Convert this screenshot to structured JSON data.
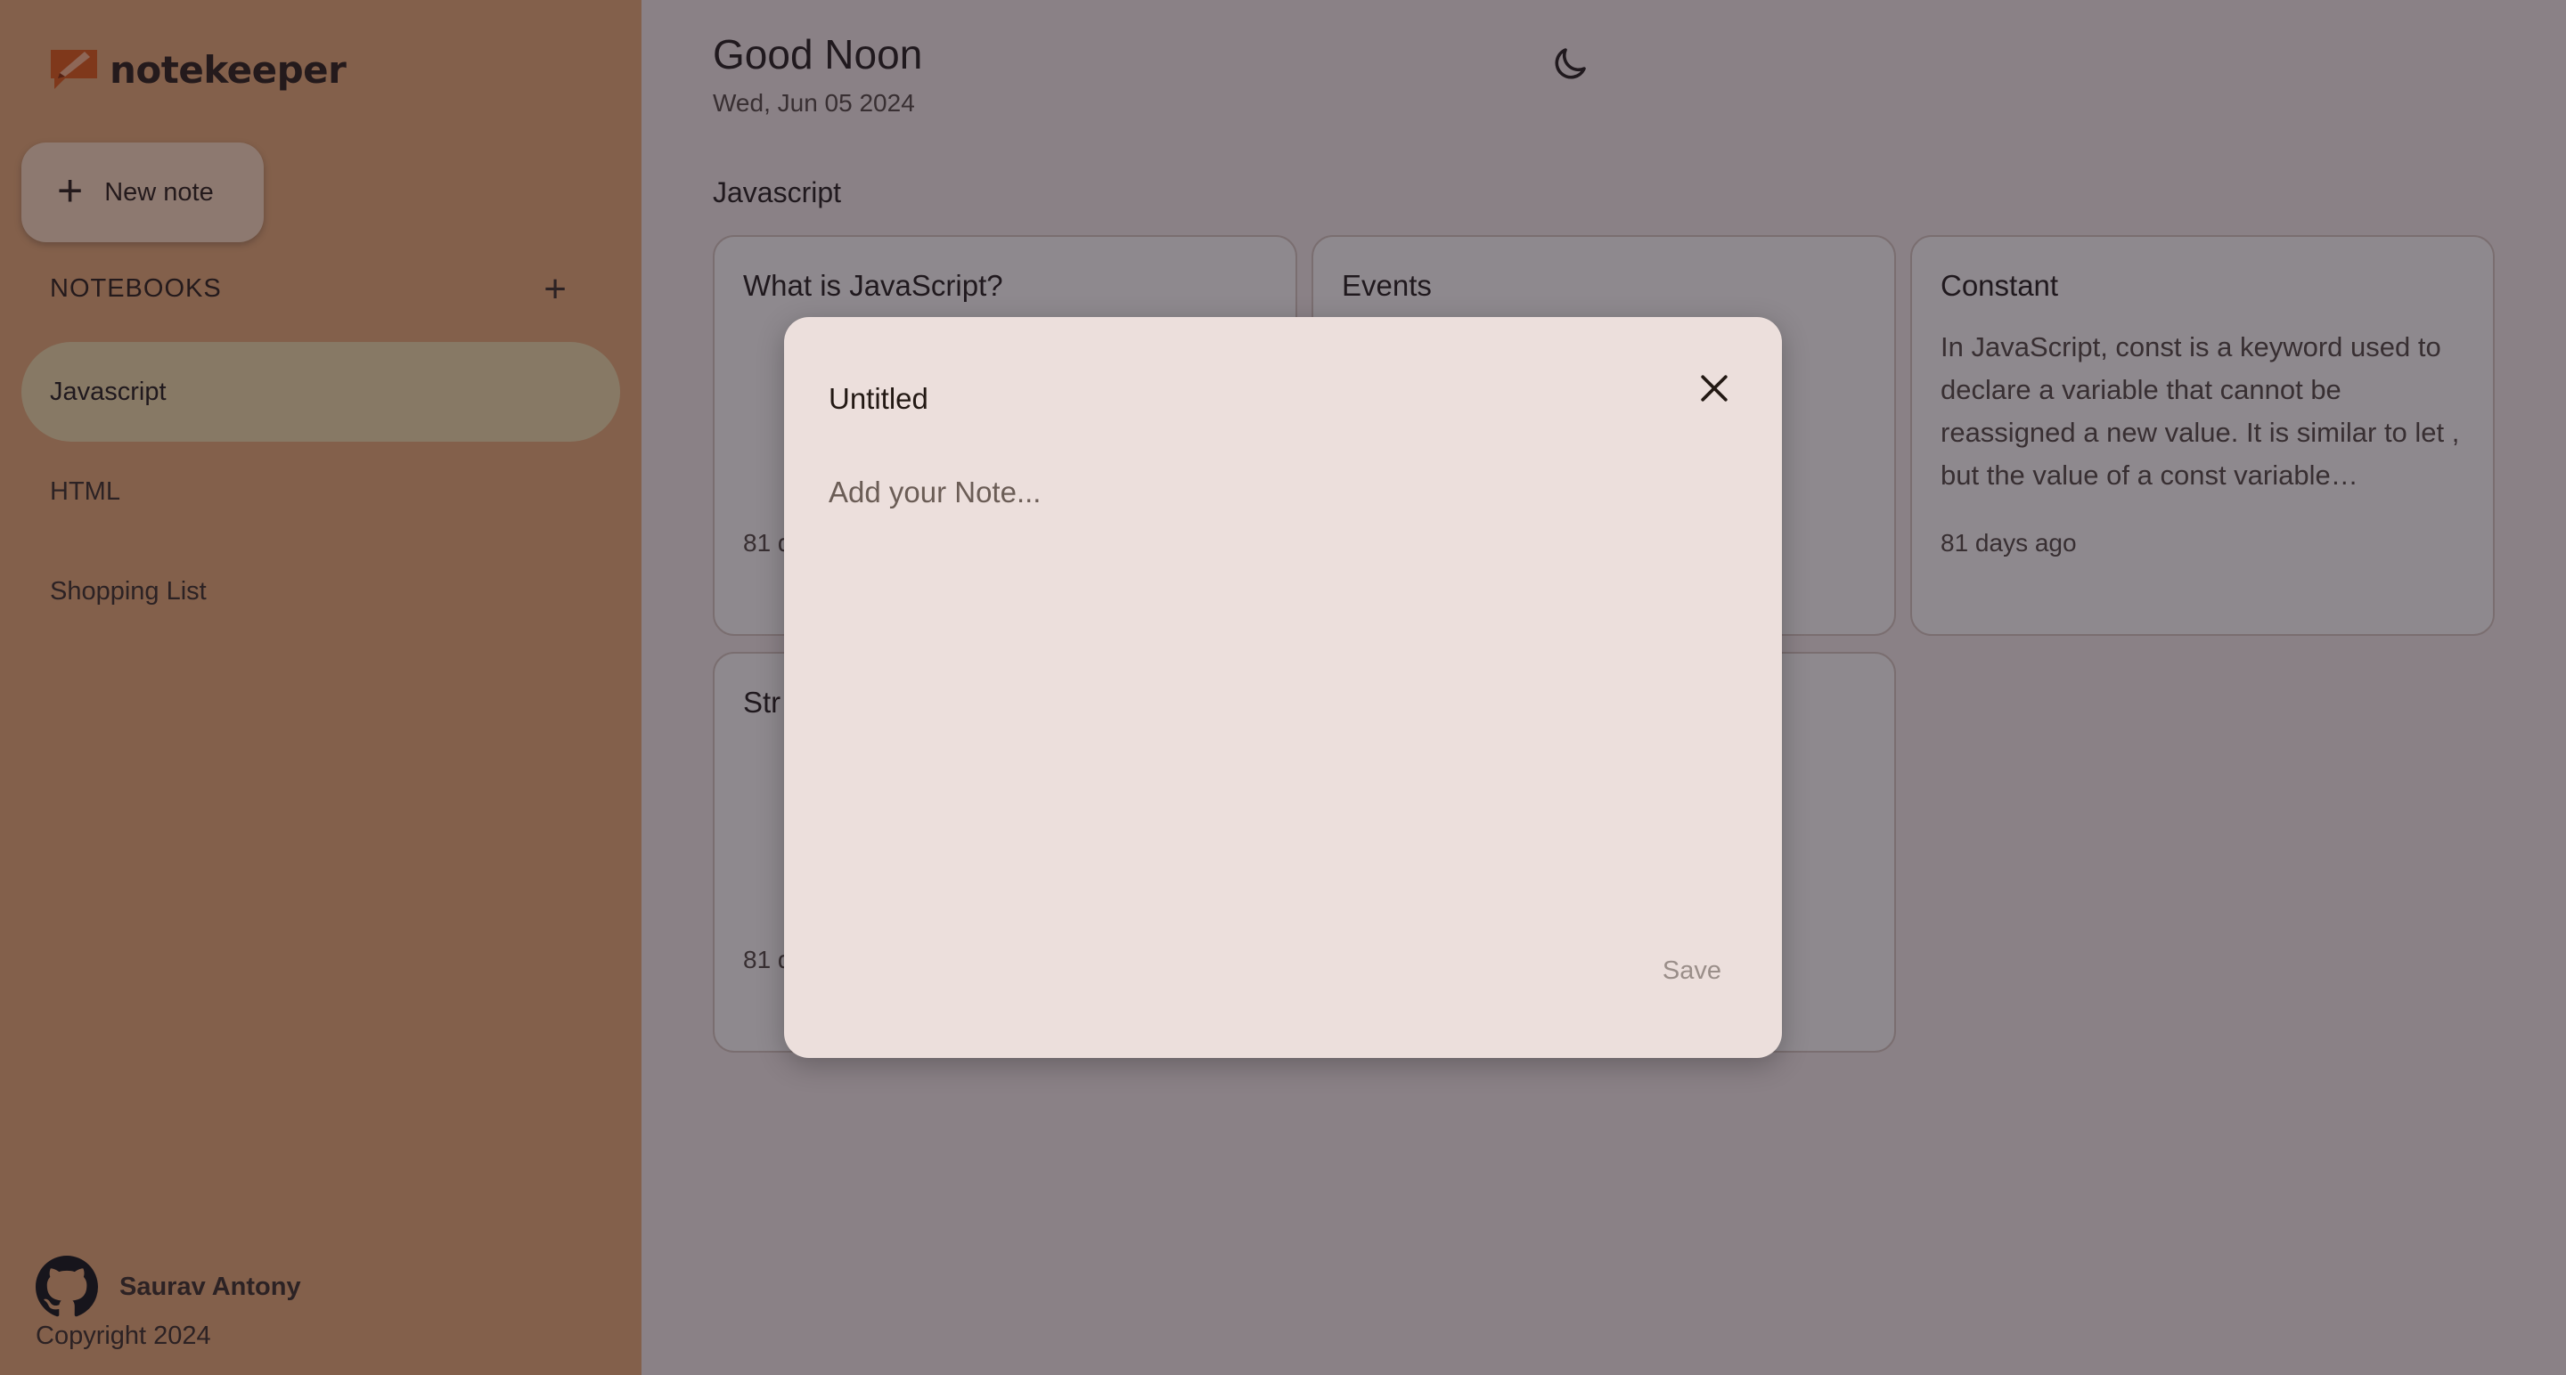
{
  "app": {
    "name": "notekeeper",
    "brand_color": "#e1570f"
  },
  "sidebar": {
    "new_note_label": "New note",
    "notebooks_header": "NOTEBOOKS",
    "notebooks": [
      {
        "label": "Javascript",
        "active": true
      },
      {
        "label": "HTML",
        "active": false
      },
      {
        "label": "Shopping List",
        "active": false
      }
    ],
    "footer": {
      "author": "Saurav Antony",
      "copyright": "Copyright 2024"
    }
  },
  "header": {
    "greeting": "Good Noon",
    "date": "Wed, Jun 05 2024",
    "theme_icon": "moon-icon"
  },
  "main": {
    "section_title": "Javascript",
    "notes": [
      {
        "title": "What is JavaScript?",
        "text": "",
        "time": "81 d"
      },
      {
        "title": "Events",
        "text": "",
        "time": ""
      },
      {
        "title": "Constant",
        "text": "In JavaScript, const is a keyword used to declare a variable that cannot be reassigned a new value. It is similar to let , but the value of a const variable…",
        "time": "81 days ago"
      },
      {
        "title": "Str",
        "text": "",
        "time": "81 d"
      },
      {
        "title": "",
        "text": "",
        "time": ""
      }
    ]
  },
  "modal": {
    "title_value": "Untitled",
    "body_placeholder": "Add your Note...",
    "save_label": "Save",
    "close_icon": "close-icon"
  }
}
